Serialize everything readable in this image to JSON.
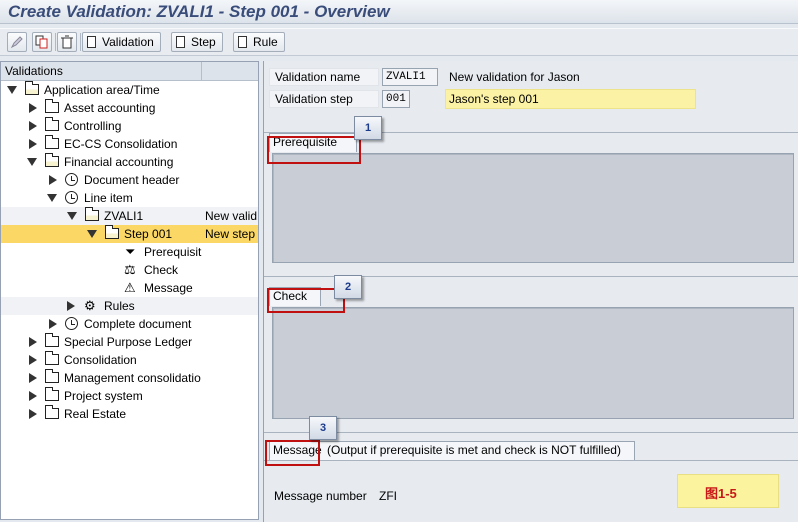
{
  "window": {
    "title": "Create Validation: ZVALI1 - Step 001 - Overview"
  },
  "toolbar": {
    "validation_label": "Validation",
    "step_label": "Step",
    "rule_label": "Rule"
  },
  "tree": {
    "header": "Validations",
    "rows": [
      {
        "label": "Application area/Time",
        "desc": ""
      },
      {
        "label": "Asset accounting",
        "desc": ""
      },
      {
        "label": "Controlling",
        "desc": ""
      },
      {
        "label": "EC-CS Consolidation",
        "desc": ""
      },
      {
        "label": "Financial accounting",
        "desc": ""
      },
      {
        "label": "Document header",
        "desc": ""
      },
      {
        "label": "Line item",
        "desc": ""
      },
      {
        "label": "ZVALI1",
        "desc": "New valid"
      },
      {
        "label": "Step 001",
        "desc": "New step"
      },
      {
        "label": "Prerequisit",
        "desc": ""
      },
      {
        "label": "Check",
        "desc": ""
      },
      {
        "label": "Message",
        "desc": ""
      },
      {
        "label": "Rules",
        "desc": ""
      },
      {
        "label": "Complete document",
        "desc": ""
      },
      {
        "label": "Special Purpose Ledger",
        "desc": ""
      },
      {
        "label": "Consolidation",
        "desc": ""
      },
      {
        "label": "Management consolidatio",
        "desc": ""
      },
      {
        "label": "Project system",
        "desc": ""
      },
      {
        "label": "Real Estate",
        "desc": ""
      }
    ]
  },
  "form": {
    "validation_name_label": "Validation name",
    "validation_name_value": "ZVALI1",
    "validation_name_desc": "New validation for Jason",
    "validation_step_label": "Validation step",
    "validation_step_value": "001",
    "validation_step_desc": "Jason's step 001",
    "prerequisite_tab": "Prerequisite",
    "check_tab": "Check",
    "message_tab": "Message",
    "message_note": "(Output if prerequisite is met and check is NOT fulfilled)",
    "message_number_label": "Message number",
    "message_number_value": "ZFI"
  },
  "callouts": [
    "1",
    "2",
    "3"
  ],
  "watermark": {
    "label": "图1-5"
  },
  "colors": {
    "title": "#3a4d7a",
    "selected_row": "#fbd866",
    "yellow_field": "#fbf2a5",
    "highlight_frame": "#c01010",
    "callout_text": "#1c3b8c"
  }
}
